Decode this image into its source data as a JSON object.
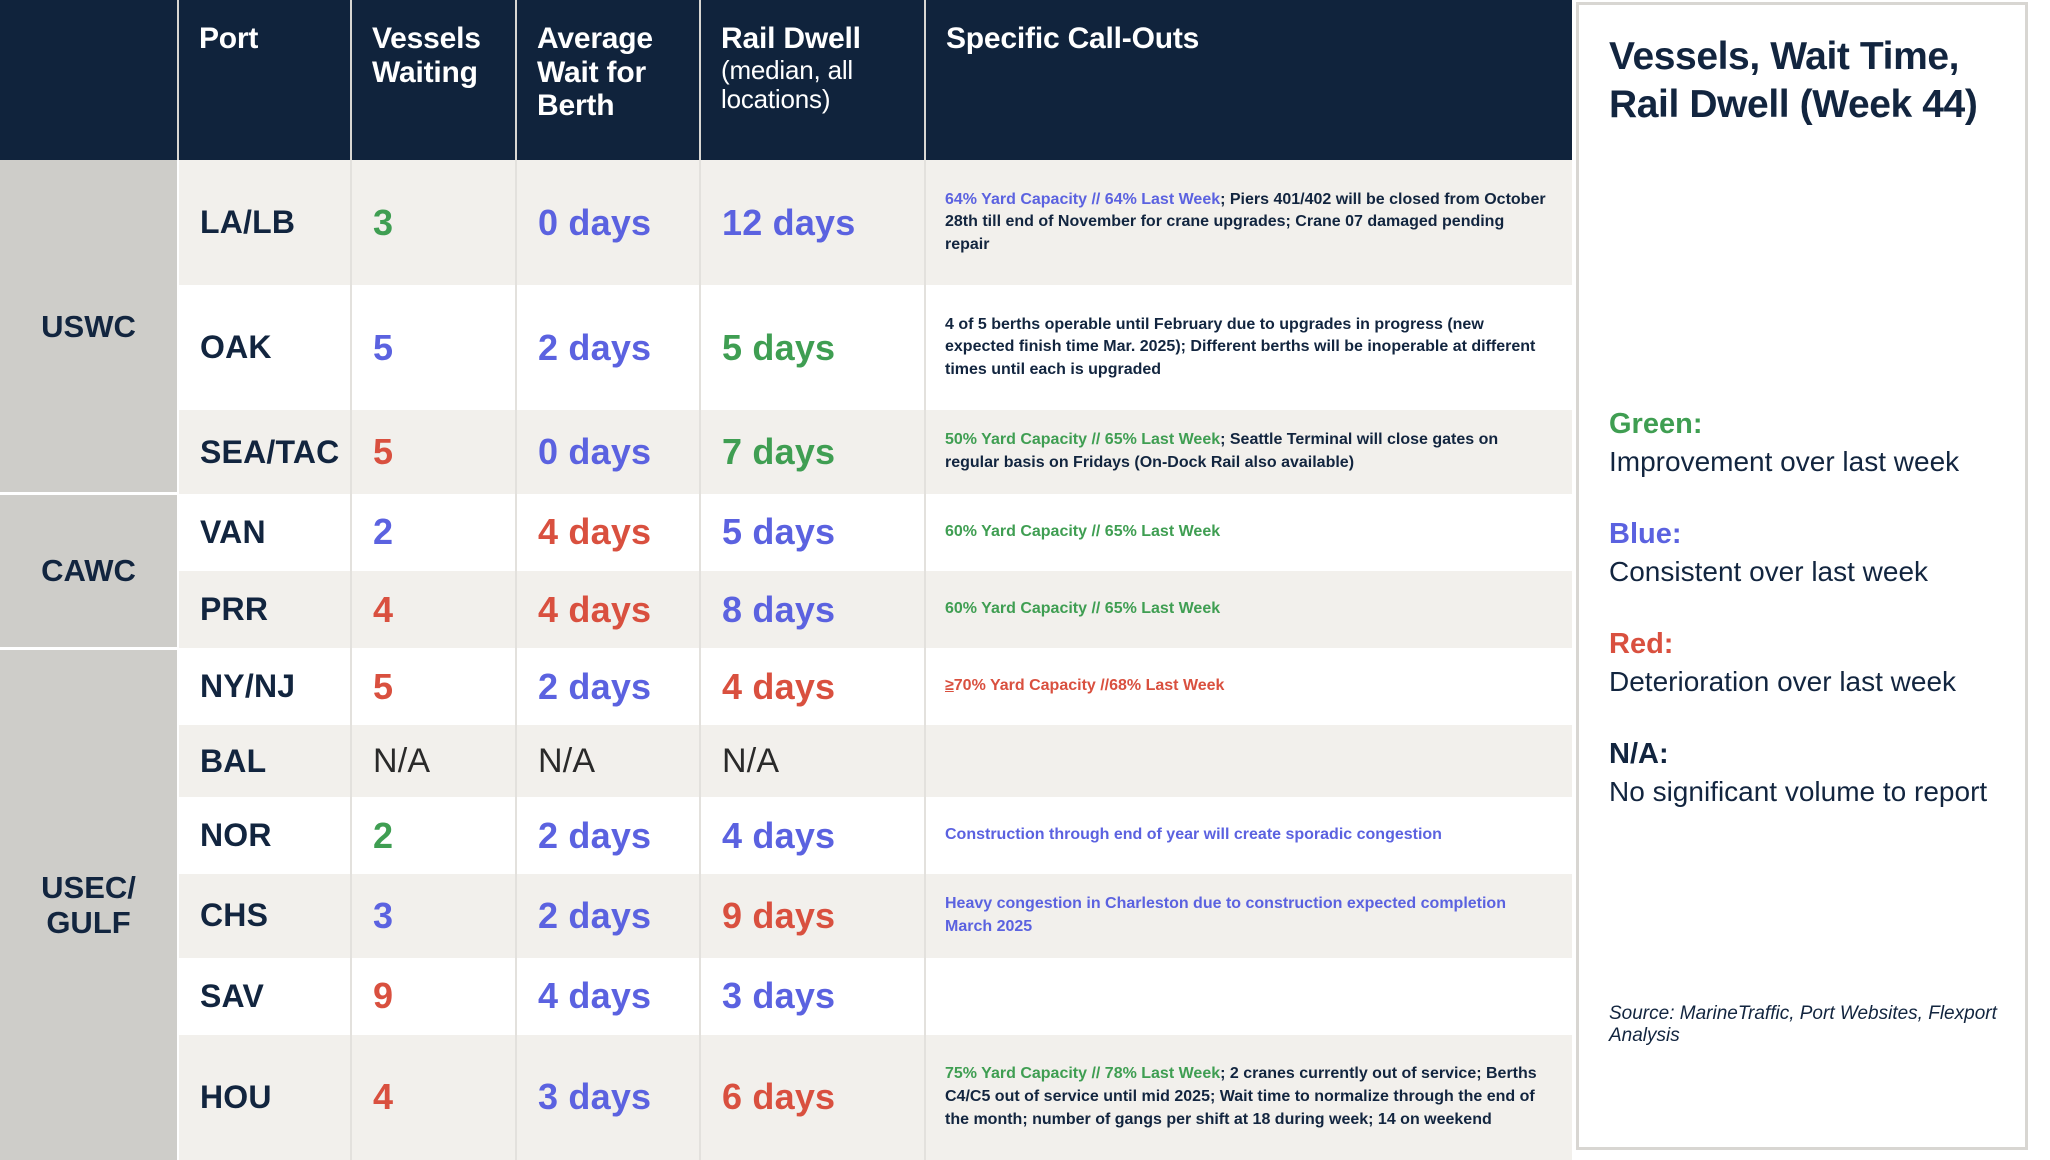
{
  "table": {
    "headers": {
      "group": "",
      "port": "Port",
      "vessels_waiting": "Vessels Waiting",
      "average_wait": "Average Wait for Berth",
      "rail_dwell": "Rail Dwell",
      "rail_dwell_sub": "(median, all locations)",
      "callouts": "Specific Call-Outs"
    },
    "groups": [
      {
        "label": "USWC",
        "rows": 3
      },
      {
        "label": "CAWC",
        "rows": 2
      },
      {
        "label": "USEC/ GULF",
        "rows": 7
      }
    ],
    "rows": [
      {
        "group": "USWC",
        "port": "LA/LB",
        "vessels_waiting": "3",
        "vessels_color": "green",
        "average_wait": "0 days",
        "average_wait_color": "blue",
        "rail_dwell": "12 days",
        "rail_dwell_color": "blue",
        "callout_lead": "64% Yard Capacity // 64% Last Week",
        "callout_lead_color": "blue",
        "callout_rest": "; Piers 401/402 will be closed from October 28th till end of November for crane upgrades; Crane 07 damaged pending repair"
      },
      {
        "group": "USWC",
        "port": "OAK",
        "vessels_waiting": "5",
        "vessels_color": "blue",
        "average_wait": "2 days",
        "average_wait_color": "blue",
        "rail_dwell": "5 days",
        "rail_dwell_color": "green",
        "callout_lead": "",
        "callout_lead_color": "navy",
        "callout_rest": "4 of 5 berths operable until February due to upgrades in progress (new expected finish time Mar. 2025); Different berths will be inoperable at different times until each is upgraded"
      },
      {
        "group": "USWC",
        "port": "SEA/TAC",
        "vessels_waiting": "5",
        "vessels_color": "red",
        "average_wait": "0 days",
        "average_wait_color": "blue",
        "rail_dwell": "7 days",
        "rail_dwell_color": "green",
        "callout_lead": "50% Yard Capacity // 65% Last Week",
        "callout_lead_color": "green",
        "callout_rest": "; Seattle Terminal will close gates on regular basis on Fridays (On-Dock Rail also available)"
      },
      {
        "group": "CAWC",
        "port": "VAN",
        "vessels_waiting": "2",
        "vessels_color": "blue",
        "average_wait": "4 days",
        "average_wait_color": "red",
        "rail_dwell": "5 days",
        "rail_dwell_color": "blue",
        "callout_lead": "60% Yard Capacity // 65% Last Week",
        "callout_lead_color": "green",
        "callout_rest": ""
      },
      {
        "group": "CAWC",
        "port": "PRR",
        "vessels_waiting": "4",
        "vessels_color": "red",
        "average_wait": "4 days",
        "average_wait_color": "red",
        "rail_dwell": "8 days",
        "rail_dwell_color": "blue",
        "callout_lead": "60% Yard Capacity // 65% Last Week",
        "callout_lead_color": "green",
        "callout_rest": ""
      },
      {
        "group": "USEC/ GULF",
        "port": "NY/NJ",
        "vessels_waiting": "5",
        "vessels_color": "red",
        "average_wait": "2 days",
        "average_wait_color": "blue",
        "rail_dwell": "4 days",
        "rail_dwell_color": "red",
        "callout_lead": "≥70% Yard Capacity //68% Last Week",
        "callout_lead_color": "red",
        "callout_rest": ""
      },
      {
        "group": "USEC/ GULF",
        "port": "BAL",
        "vessels_waiting": "N/A",
        "vessels_color": "na",
        "average_wait": "N/A",
        "average_wait_color": "na",
        "rail_dwell": "N/A",
        "rail_dwell_color": "na",
        "callout_lead": "",
        "callout_lead_color": "navy",
        "callout_rest": ""
      },
      {
        "group": "USEC/ GULF",
        "port": "NOR",
        "vessels_waiting": "2",
        "vessels_color": "green",
        "average_wait": "2 days",
        "average_wait_color": "blue",
        "rail_dwell": "4 days",
        "rail_dwell_color": "blue",
        "callout_lead": "Construction through end of year will create sporadic congestion",
        "callout_lead_color": "blue",
        "callout_rest": ""
      },
      {
        "group": "USEC/ GULF",
        "port": "CHS",
        "vessels_waiting": "3",
        "vessels_color": "blue",
        "average_wait": "2 days",
        "average_wait_color": "blue",
        "rail_dwell": "9 days",
        "rail_dwell_color": "red",
        "callout_lead": "Heavy congestion in Charleston due to construction expected completion March 2025",
        "callout_lead_color": "blue",
        "callout_rest": ""
      },
      {
        "group": "USEC/ GULF",
        "port": "SAV",
        "vessels_waiting": "9",
        "vessels_color": "red",
        "average_wait": "4 days",
        "average_wait_color": "blue",
        "rail_dwell": "3 days",
        "rail_dwell_color": "blue",
        "callout_lead": "",
        "callout_lead_color": "navy",
        "callout_rest": ""
      },
      {
        "group": "USEC/ GULF",
        "port": "HOU",
        "vessels_waiting": "4",
        "vessels_color": "red",
        "average_wait": "3 days",
        "average_wait_color": "blue",
        "rail_dwell": "6 days",
        "rail_dwell_color": "red",
        "callout_lead": "75% Yard Capacity // 78% Last Week",
        "callout_lead_color": "green",
        "callout_rest": "; 2 cranes currently out of service; Berths C4/C5 out of service until mid 2025; Wait time to normalize through the end of the month; number of gangs per shift at 18 during week; 14 on weekend"
      }
    ]
  },
  "panel": {
    "title": "Vessels, Wait Time, Rail Dwell (Week 44)",
    "legend": [
      {
        "key": "Green:",
        "desc": "Improvement over last week",
        "color": "#3f9e52"
      },
      {
        "key": "Blue:",
        "desc": "Consistent over last week",
        "color": "#5b62e0"
      },
      {
        "key": "Red:",
        "desc": "Deterioration over last week",
        "color": "#d9503f"
      },
      {
        "key": "N/A:",
        "desc": "No significant volume to report",
        "color": "#12253f"
      }
    ],
    "source": "Source: MarineTraffic, Port Websites, Flexport Analysis"
  },
  "colors": {
    "header_navy": "#10233c",
    "group_gray": "#cecdc9",
    "row_alt": "#f2f0ec",
    "green": "#3f9e52",
    "blue": "#5b62e0",
    "red": "#d9503f",
    "navy_text": "#12253f"
  }
}
